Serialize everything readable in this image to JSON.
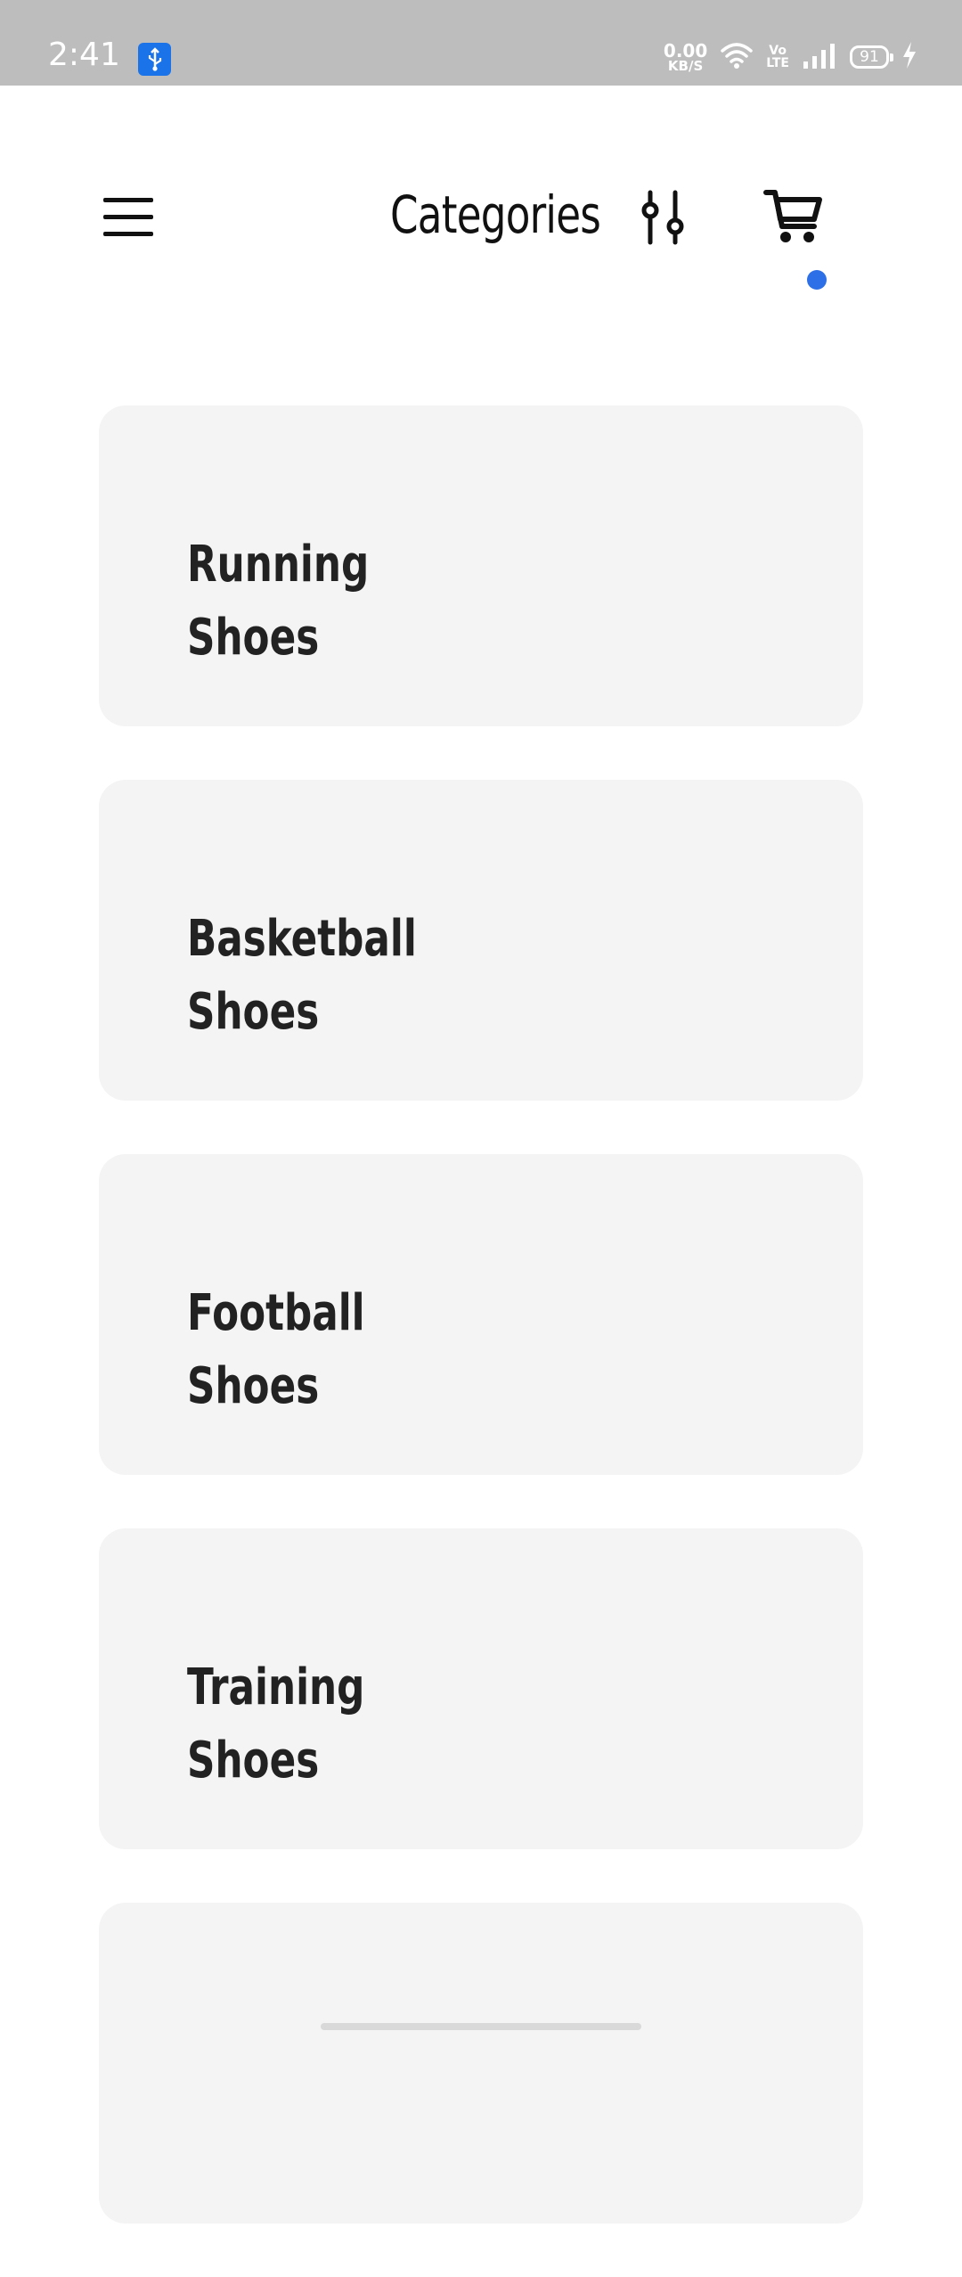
{
  "status_bar": {
    "time": "2:41",
    "net_speed_value": "0.00",
    "net_speed_unit": "KB/S",
    "volte_line1": "Vo",
    "volte_line2": "LTE",
    "battery_level": "91",
    "usb_icon": "usb-icon",
    "wifi_icon": "wifi-icon",
    "signal_icon": "signal-icon",
    "charging_icon": "charging-bolt-icon"
  },
  "header": {
    "title": "Categories",
    "menu_icon": "hamburger-menu-icon",
    "filter_icon": "filter-sliders-icon",
    "cart_icon": "shopping-cart-icon",
    "cart_badge_color": "#2d6fe6"
  },
  "categories": [
    {
      "label": "Running\nShoes"
    },
    {
      "label": "Basketball\nShoes"
    },
    {
      "label": "Football\nShoes"
    },
    {
      "label": "Training\nShoes"
    },
    {
      "label": ""
    }
  ],
  "colors": {
    "status_bar_bg": "#bdbdbd",
    "card_bg": "#f4f4f4",
    "text_dark": "#222222"
  }
}
